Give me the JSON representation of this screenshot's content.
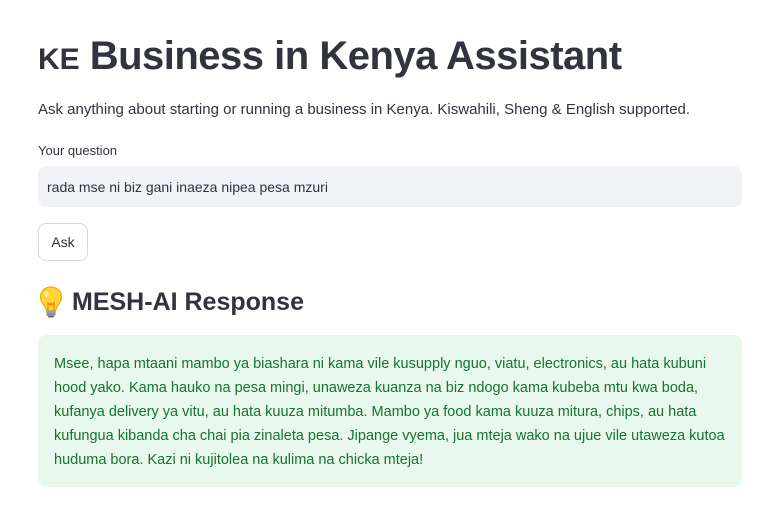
{
  "header": {
    "flag_text": "KE",
    "title": "Business in Kenya Assistant",
    "subtitle": "Ask anything about starting or running a business in Kenya. Kiswahili, Sheng & English supported."
  },
  "question": {
    "label": "Your question",
    "value": "rada mse ni biz gani inaeza nipea pesa mzuri"
  },
  "ask_button": {
    "label": "Ask"
  },
  "response": {
    "heading": "MESH-AI Response",
    "heading_icon": "lightbulb-icon",
    "text": "Msee, hapa mtaani mambo ya biashara ni kama vile kusupply nguo, viatu, electronics, au hata kubuni hood yako. Kama hauko na pesa mingi, unaweza kuanza na biz ndogo kama kubeba mtu kwa boda, kufanya delivery ya vitu, au hata kuuza mitumba. Mambo ya food kama kuuza mitura, chips, au hata kufungua kibanda cha chai pia zinaleta pesa. Jipange vyema, jua mteja wako na ujue vile utaweza kutoa huduma bora. Kazi ni kujitolea na kulima na chicka mteja!"
  },
  "colors": {
    "text": "#31333f",
    "input_bg": "#f0f2f6",
    "success_bg": "#e8f8ec",
    "success_text": "#177233"
  }
}
